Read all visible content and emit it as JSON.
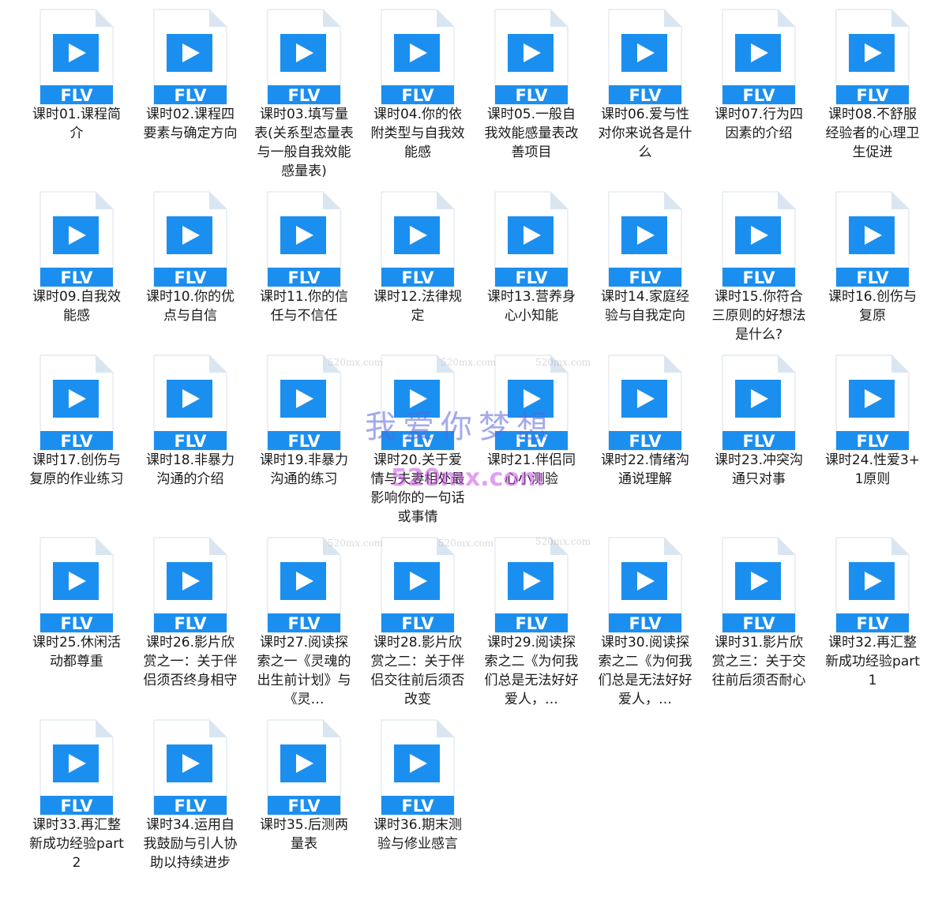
{
  "file_icon": {
    "type_label": "FLV",
    "icon_name": "flv-video-file-icon",
    "accent_color": "#1b8ff0",
    "page_color": "#ffffff",
    "fold_color": "#d9e6f2"
  },
  "files": [
    "课时01.课程简介",
    "课时02.课程四要素与确定方向",
    "课时03.填写量表(关系型态量表与一般自我效能感量表)",
    "课时04.你的依附类型与自我效能感",
    "课时05.一般自我效能感量表改善项目",
    "课时06.爱与性对你来说各是什么",
    "课时07.行为四因素的介绍",
    "课时08.不舒服经验者的心理卫生促进",
    "课时09.自我效能感",
    "课时10.你的优点与自信",
    "课时11.你的信任与不信任",
    "课时12.法律规定",
    "课时13.营养身心小知能",
    "课时14.家庭经验与自我定向",
    "课时15.你符合三原则的好想法是什么?",
    "课时16.创伤与复原",
    "课时17.创伤与复原的作业练习",
    "课时18.非暴力沟通的介绍",
    "课时19.非暴力沟通的练习",
    "课时20.关于爱情与夫妻相处最影响你的一句话或事情",
    "课时21.伴侣同心小测验",
    "课时22.情绪沟通说理解",
    "课时23.冲突沟通只对事",
    "课时24.性爱3+1原则",
    "课时25.休闲活动都尊重",
    "课时26.影片欣赏之一：关于伴侣须否终身相守",
    "课时27.阅读探索之一《灵魂的出生前计划》与《灵…",
    "课时28.影片欣赏之二：关于伴侣交往前后须否改变",
    "课时29.阅读探索之二《为何我们总是无法好好爱人，…",
    "课时30.阅读探索之二《为何我们总是无法好好爱人，…",
    "课时31.影片欣赏之三：关于交往前后须否耐心",
    "课时32.再汇整新成功经验part1",
    "课时33.再汇整新成功经验part2",
    "课时34.运用自我鼓励与引人协助以持续进步",
    "课时35.后测两量表",
    "课时36.期末测验与修业感言"
  ],
  "watermarks": {
    "big_text": "我爱你梦想",
    "url_text": "520mx.com",
    "small_text": "520mx.com"
  }
}
